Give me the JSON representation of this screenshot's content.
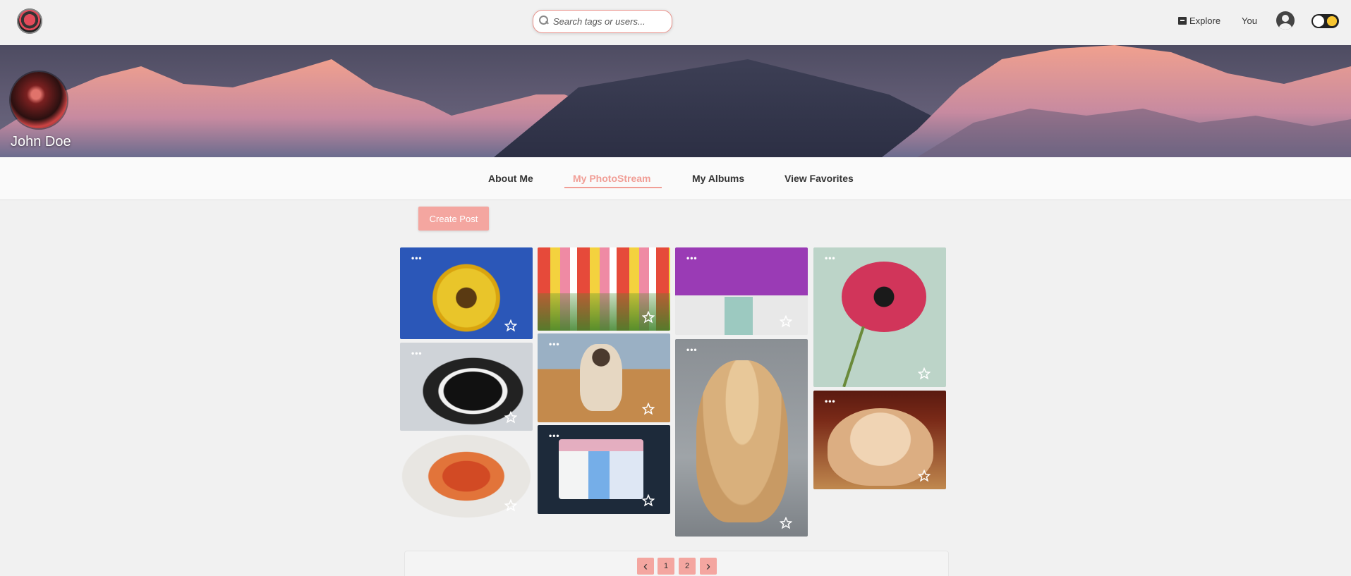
{
  "header": {
    "search_placeholder": "Search tags or users...",
    "explore_label": "Explore",
    "you_label": "You"
  },
  "profile": {
    "name": "John Doe"
  },
  "tabs": [
    {
      "label": "About Me",
      "active": false
    },
    {
      "label": "My PhotoStream",
      "active": true
    },
    {
      "label": "My Albums",
      "active": false
    },
    {
      "label": "View Favorites",
      "active": false
    }
  ],
  "actions": {
    "create_post_label": "Create Post"
  },
  "photos": [
    {
      "subject": "sunflower",
      "menu": "•••"
    },
    {
      "subject": "black-and-white cat",
      "menu": "•••"
    },
    {
      "subject": "spaghetti plate",
      "menu": ""
    },
    {
      "subject": "tulips",
      "menu": ""
    },
    {
      "subject": "siamese cat",
      "menu": "•••"
    },
    {
      "subject": "dashboard illustration",
      "menu": "•••"
    },
    {
      "subject": "purple flowers doorway",
      "menu": "•••"
    },
    {
      "subject": "golden cat",
      "menu": "•••"
    },
    {
      "subject": "pink anemone",
      "menu": "•••"
    },
    {
      "subject": "persian cat",
      "menu": "•••"
    }
  ],
  "pagination": {
    "prev": "‹",
    "pages": [
      "1",
      "2"
    ],
    "next": "›"
  },
  "colors": {
    "accent": "#f19e96",
    "button": "#f4a6a0"
  }
}
